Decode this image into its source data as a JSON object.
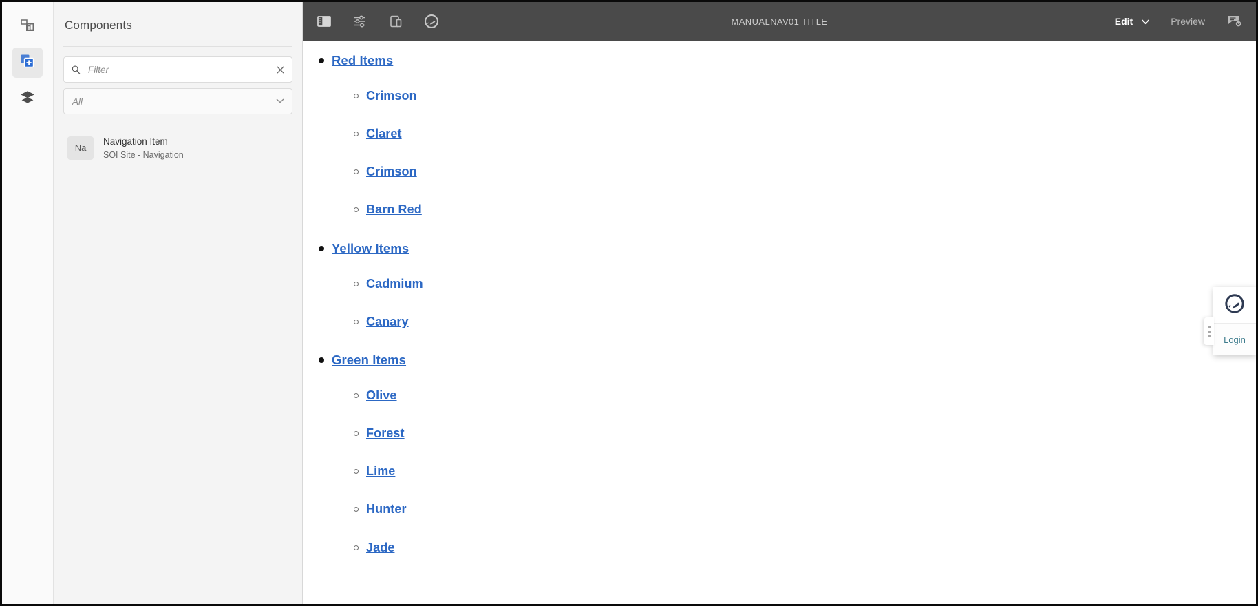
{
  "rail": {
    "items": [
      {
        "name": "page-content-icon",
        "label": "Page content",
        "active": false
      },
      {
        "name": "components-icon",
        "label": "Components",
        "active": true
      },
      {
        "name": "layers-icon",
        "label": "Layers",
        "active": false
      }
    ]
  },
  "panel": {
    "title": "Components",
    "filter": {
      "placeholder": "Filter",
      "value": "",
      "clear_label": "Clear"
    },
    "category": {
      "selected": "All"
    },
    "components": [
      {
        "thumb": "Na",
        "name": "Navigation Item",
        "group": "SOI Site - Navigation"
      }
    ]
  },
  "toolbar": {
    "icons": [
      {
        "name": "toggle-side-panel-icon",
        "label": "Toggle side panel"
      },
      {
        "name": "page-properties-icon",
        "label": "Page properties"
      },
      {
        "name": "emulator-icon",
        "label": "Layout emulator"
      },
      {
        "name": "site-logo-icon",
        "label": "Site logo"
      }
    ],
    "title": "MANUALNAV01 TITLE",
    "edit_label": "Edit",
    "preview_label": "Preview",
    "annotations_label": "Annotations"
  },
  "canvas": {
    "nav": [
      {
        "label": "Red Items",
        "children": [
          {
            "label": "Crimson"
          },
          {
            "label": "Claret"
          },
          {
            "label": "Crimson"
          },
          {
            "label": "Barn Red"
          }
        ]
      },
      {
        "label": "Yellow Items",
        "children": [
          {
            "label": "Cadmium"
          },
          {
            "label": "Canary"
          }
        ]
      },
      {
        "label": "Green Items",
        "children": [
          {
            "label": "Olive"
          },
          {
            "label": "Forest"
          },
          {
            "label": "Lime"
          },
          {
            "label": "Hunter"
          },
          {
            "label": "Jade"
          }
        ]
      }
    ]
  },
  "login_widget": {
    "logo_label": "Site logo",
    "login_label": "Login"
  },
  "colors": {
    "link": "#2c68c4",
    "toolbar_bg": "#4a4a4a",
    "accent_blue": "#2b6cd4",
    "login_teal": "#3f7d8e",
    "logo_navy": "#2e3a52"
  }
}
